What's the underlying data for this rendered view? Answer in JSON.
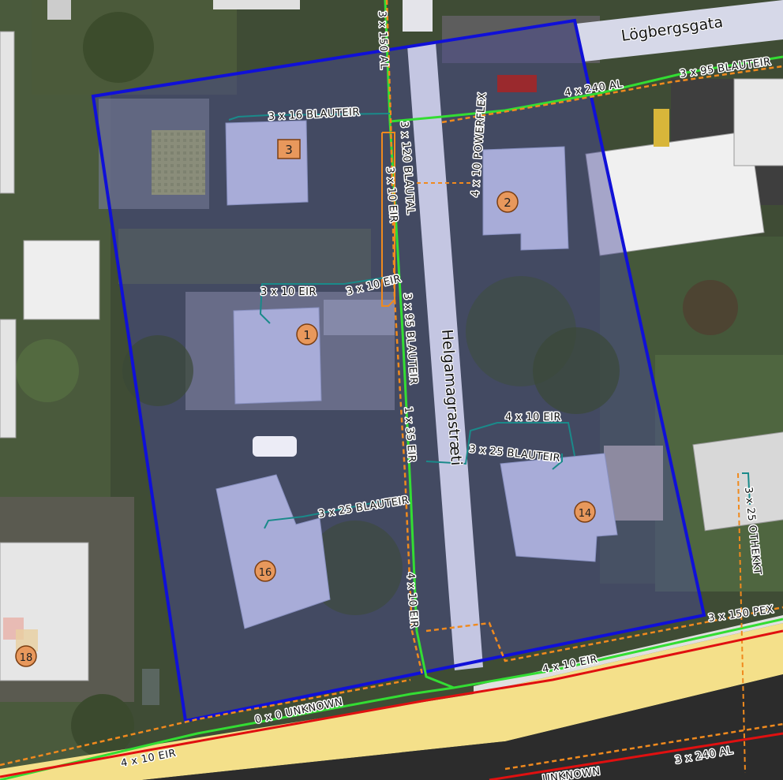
{
  "map": {
    "streets": [
      "Lögbergsgata",
      "Helgamagrastræti"
    ],
    "building_numbers": [
      "1",
      "2",
      "3",
      "14",
      "16",
      "18"
    ],
    "cable_labels": [
      "3 x 150 AL",
      "3 x 16 BLAUTEIR",
      "3 x 120 BLAUTAL",
      "3 x 10 EIR",
      "3 x 10 EIR",
      "3 x 10 EIR",
      "3 x 95 BLAUTEIR",
      "1 x 35 EIR",
      "3 x 25 BLAUTEIR",
      "4 x 10 EIR",
      "4 x 240 AL",
      "3 x 95 BLAUTEIR",
      "4 x 10 POWERFLEX",
      "4 x 10 EIR",
      "3 x 25 BLAUTEIR",
      "3 x 25 OTHEKKT",
      "3 x 150 PEX",
      "4 x 10 EIR",
      "0 x 0 UNKNOWN",
      "4 x 10 EIR",
      "3 x 240 AL",
      "UNKNOWN"
    ],
    "colors": {
      "boundary": "#1010d8",
      "building": "#a8acd8",
      "cable_green": "#33dd33",
      "cable_orange": "#f08a1e",
      "cable_red": "#e01010",
      "service_line": "#1a8a8a",
      "main_road": "#f4e08a",
      "street": "#c4c6e2",
      "marker": "#e8985c"
    }
  }
}
